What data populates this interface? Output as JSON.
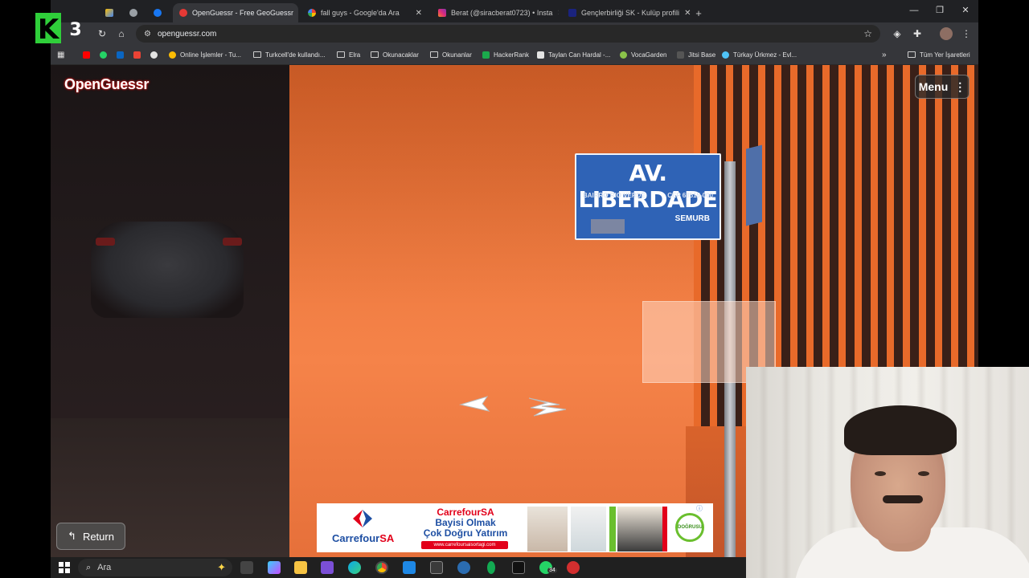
{
  "browser": {
    "tabs": [
      {
        "title": "",
        "active": false
      },
      {
        "title": "",
        "active": false
      },
      {
        "title": "OpenGuessr - Free GeoGuessr",
        "active": true
      },
      {
        "title": "fall guys - Google'da Ara",
        "active": false
      },
      {
        "title": "Berat (@siracberat0723) • Insta",
        "active": false
      },
      {
        "title": "Gençlerbirliği SK - Kulüp profili",
        "active": false
      }
    ],
    "new_tab_label": "+",
    "address": "openguessr.com",
    "bookmarks": [
      "Online İşlemler - Tu...",
      "Turkcell'de kullandı...",
      "Elra",
      "Okunacaklar",
      "Okunanlar",
      "HackerRank",
      "Taylan Can Hardal -...",
      "VocaGarden",
      "Jitsi Base",
      "Türkay Ürkmez - Evl...",
      "Tüm Yer İşaretleri"
    ]
  },
  "game": {
    "brand": "OpenGuessr",
    "menu_label": "Menu",
    "return_label": "Return",
    "street_sign": {
      "name": "AV. LIBERDADE",
      "district": "BAIRRO RIO VERDE",
      "cep": "CEP 68515-000",
      "agency": "SEMURB"
    }
  },
  "ad": {
    "brand_prefix": "Carrefour",
    "brand_suffix": "SA",
    "line1": "CarrefourSA",
    "line2": "Bayisi Olmak",
    "line3": "Çok Doğru Yatırım",
    "url": "www.carrefoursaisortagi.com",
    "badge": "DOĞRUSU"
  },
  "overlay": {
    "logo_letter": "K",
    "logo_number": "3"
  },
  "taskbar": {
    "search_placeholder": "Ara",
    "whatsapp_count": "34"
  },
  "colors": {
    "accent_red": "#e2001a",
    "carrefour_blue": "#1e4fa3",
    "sign_blue": "#2f63b6",
    "wall_orange": "#ee7a3f",
    "k3_green": "#2fcf3a"
  }
}
